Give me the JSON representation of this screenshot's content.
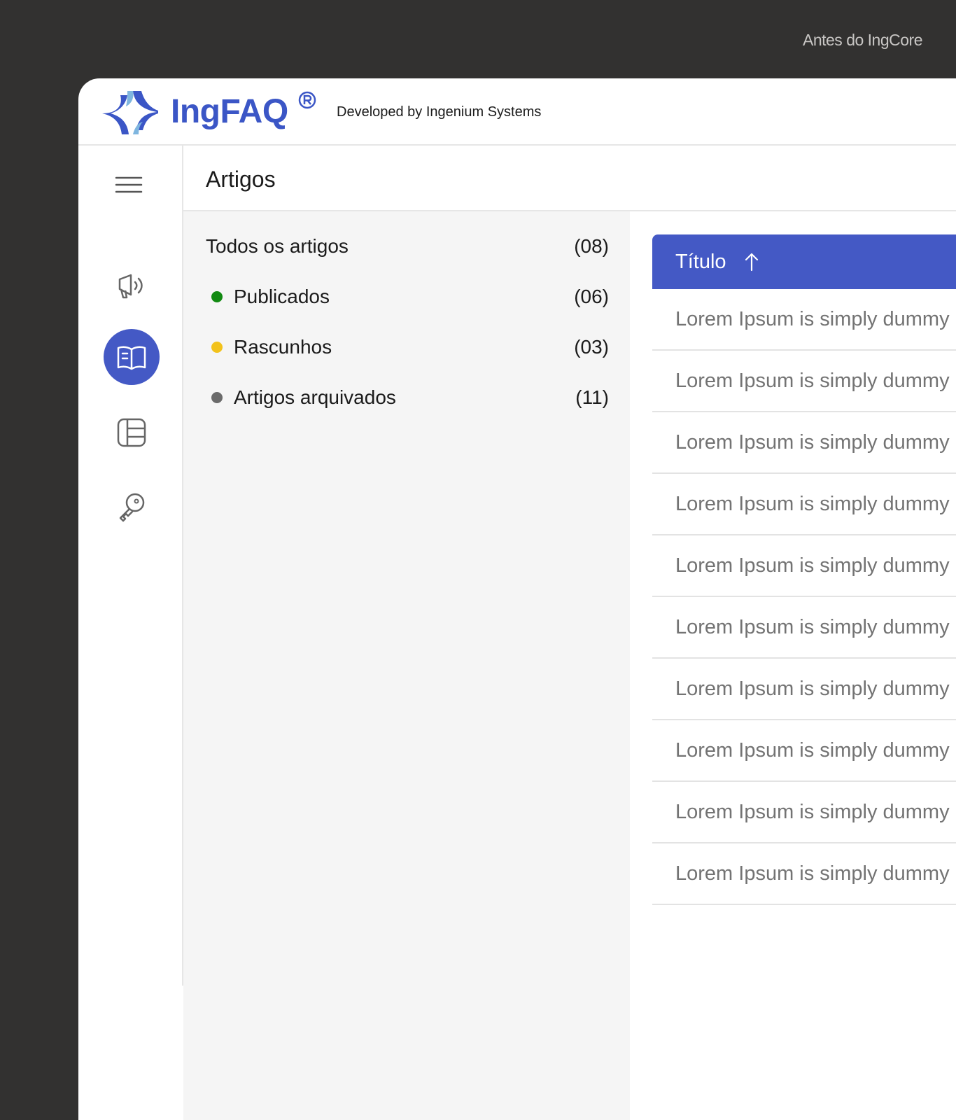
{
  "caption": "Antes do IngCore",
  "brand": {
    "name": "IngFAQ",
    "tagline": "Developed by Ingenium Systems",
    "primary_color": "#3B56C6",
    "secondary_color": "#7FB6DF"
  },
  "sidebar": {
    "items": [
      {
        "icon": "menu-icon"
      },
      {
        "icon": "megaphone-icon"
      },
      {
        "icon": "book-icon",
        "active": true
      },
      {
        "icon": "layout-icon"
      },
      {
        "icon": "key-icon"
      }
    ],
    "active_color": "#4459C5"
  },
  "page": {
    "title": "Artigos"
  },
  "filters": [
    {
      "label": "Todos os artigos",
      "count": "(08)"
    },
    {
      "label": "Publicados",
      "count": "(06)",
      "dot_color": "#128A12"
    },
    {
      "label": "Rascunhos",
      "count": "(03)",
      "dot_color": "#F2C21B"
    },
    {
      "label": "Artigos arquivados",
      "count": "(11)",
      "dot_color": "#6B6B6B"
    }
  ],
  "table": {
    "header": {
      "label": "Título",
      "sort": "ascending",
      "color": "#4459C5"
    },
    "rows": [
      "Lorem Ipsum is simply dummy",
      "Lorem Ipsum is simply dummy",
      "Lorem Ipsum is simply dummy",
      "Lorem Ipsum is simply dummy",
      "Lorem Ipsum is simply dummy",
      "Lorem Ipsum is simply dummy",
      "Lorem Ipsum is simply dummy",
      "Lorem Ipsum is simply dummy",
      "Lorem Ipsum is simply dummy",
      "Lorem Ipsum is simply dummy"
    ]
  }
}
